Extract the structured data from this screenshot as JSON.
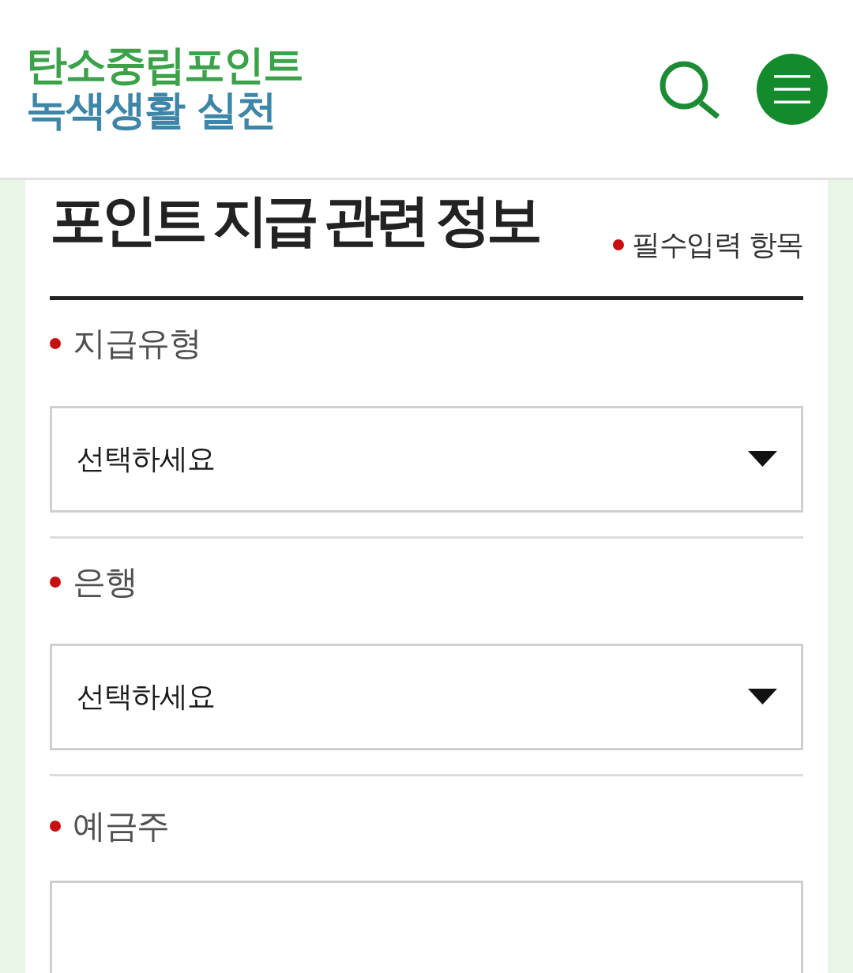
{
  "header": {
    "logo": {
      "line_1": "탄소중립포인트",
      "line_2": "녹색생활 실천"
    }
  },
  "section": {
    "title": "포인트 지급 관련 정보",
    "required_note": "필수입력 항목"
  },
  "fields": [
    {
      "kind": "select",
      "label": "지급유형",
      "required": true,
      "value": "선택하세요"
    },
    {
      "kind": "select",
      "label": "은행",
      "required": true,
      "value": "선택하세요"
    },
    {
      "kind": "text",
      "label": "예금주",
      "required": true
    }
  ]
}
